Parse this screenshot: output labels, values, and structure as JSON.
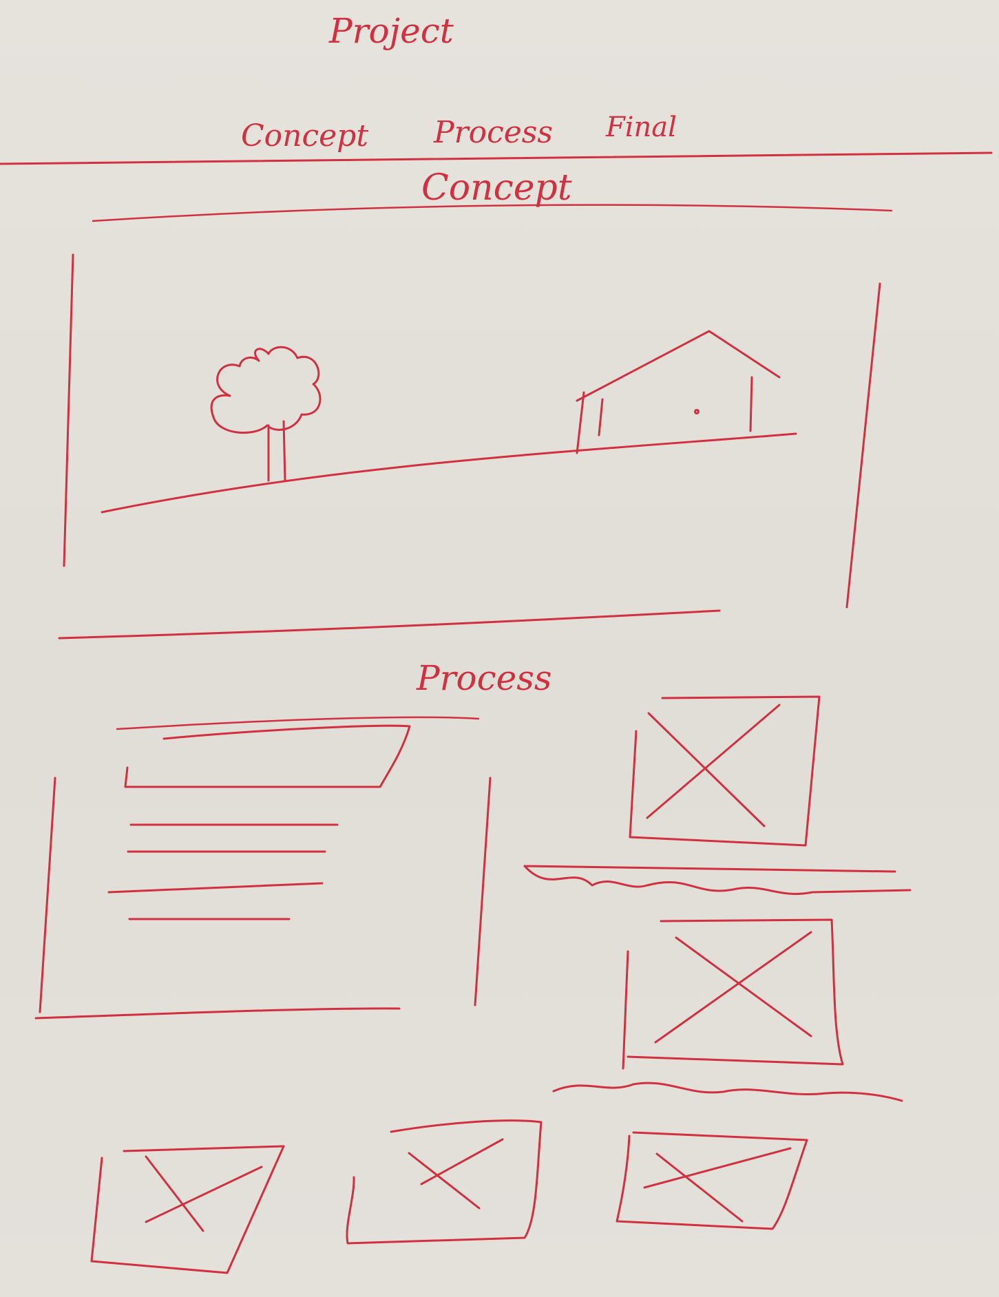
{
  "title": "Project",
  "nav": {
    "concept": "Concept",
    "process": "Process",
    "final": "Final"
  },
  "sections": {
    "concept": {
      "heading": "Concept",
      "hero_icons": [
        "tree-icon",
        "house-icon"
      ]
    },
    "process": {
      "heading": "Process",
      "text_block_lines": 4,
      "images_right": 2,
      "images_bottom": 3
    }
  },
  "ink_color": "#d0303f",
  "paper_color": "#e2e0d8"
}
